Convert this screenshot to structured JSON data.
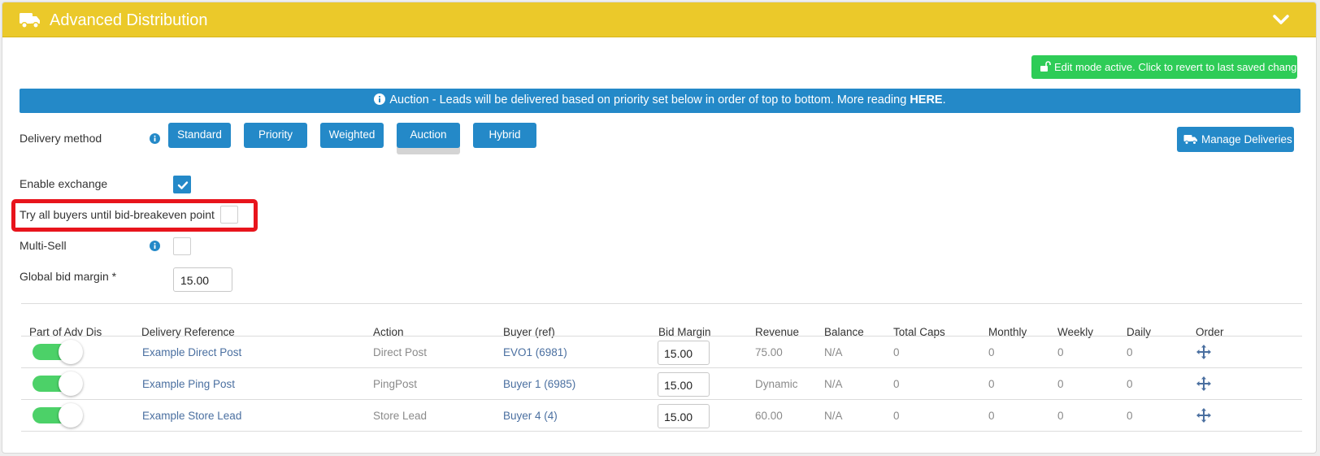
{
  "header": {
    "title": "Advanced Distribution",
    "truck_icon": "truck-icon",
    "collapse_icon": "chevron-down-icon"
  },
  "edit_button": {
    "label": "Edit mode active. Click to revert to last saved changes",
    "icon": "unlock-icon"
  },
  "info_bar": {
    "text": "Auction - Leads will be delivered based on priority set below in order of top to bottom. More reading ",
    "link": "HERE",
    "suffix": ".",
    "icon": "info-icon"
  },
  "delivery": {
    "label": "Delivery method",
    "methods": [
      "Standard",
      "Priority",
      "Weighted",
      "Auction",
      "Hybrid"
    ],
    "selected": "Auction"
  },
  "manage_button": {
    "label": "Manage Deliveries",
    "icon": "truck-icon"
  },
  "options": {
    "enable_exchange": {
      "label": "Enable exchange",
      "checked": true
    },
    "try_all_buyers": {
      "label": "Try all buyers until bid-breakeven point",
      "checked": false
    },
    "multi_sell": {
      "label": "Multi-Sell",
      "checked": false
    },
    "global_bid_margin": {
      "label": "Global bid margin *",
      "value": "15.00"
    }
  },
  "table": {
    "headers": [
      "Part of Adv Dis",
      "Delivery Reference",
      "Action",
      "Buyer (ref)",
      "Bid Margin",
      "Revenue",
      "Balance",
      "Total Caps",
      "Monthly",
      "Weekly",
      "Daily",
      "Order"
    ],
    "rows": [
      {
        "enabled": true,
        "reference": "Example Direct Post",
        "action": "Direct Post",
        "buyer": "EVO1 (6981)",
        "bid_margin": "15.00",
        "revenue": "75.00",
        "balance": "N/A",
        "total_caps": "0",
        "monthly": "0",
        "weekly": "0",
        "daily": "0"
      },
      {
        "enabled": true,
        "reference": "Example Ping Post",
        "action": "PingPost",
        "buyer": "Buyer 1 (6985)",
        "bid_margin": "15.00",
        "revenue": "Dynamic",
        "balance": "N/A",
        "total_caps": "0",
        "monthly": "0",
        "weekly": "0",
        "daily": "0"
      },
      {
        "enabled": true,
        "reference": "Example Store Lead",
        "action": "Store Lead",
        "buyer": "Buyer 4 (4)",
        "bid_margin": "15.00",
        "revenue": "60.00",
        "balance": "N/A",
        "total_caps": "0",
        "monthly": "0",
        "weekly": "0",
        "daily": "0"
      }
    ]
  },
  "colors": {
    "header_yellow": "#ebc92a",
    "primary_blue": "#2489c8",
    "success_green": "#2ecc57",
    "toggle_green": "#4cd168",
    "highlight_red": "#e8141c"
  }
}
